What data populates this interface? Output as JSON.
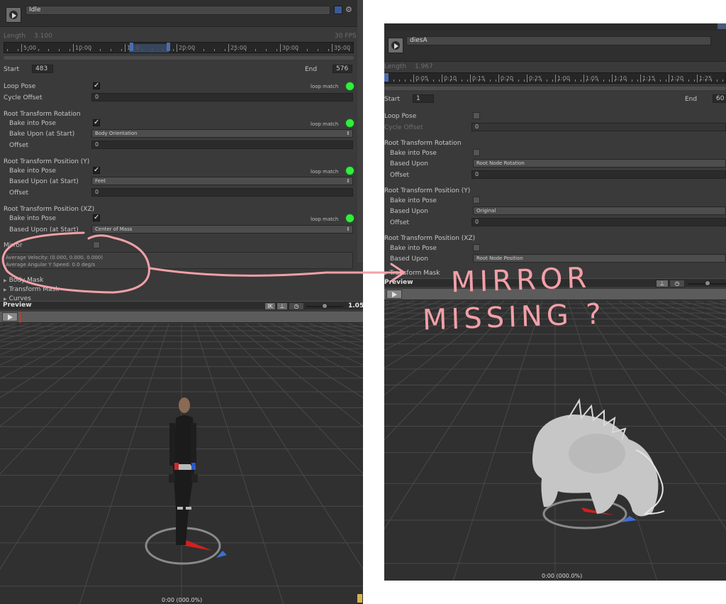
{
  "left_panel": {
    "clip_name": "Idle",
    "length_label": "Length",
    "length_value": "3.100",
    "fps": "30 FPS",
    "timeline_labels": [
      "5:00",
      "10:00",
      "1┃:0",
      "20:00",
      "25:00",
      "30:00",
      "35:00"
    ],
    "start_label": "Start",
    "start_value": "483",
    "end_label": "End",
    "end_value": "576",
    "loop_pose_label": "Loop Pose",
    "loop_match": "loop match",
    "cycle_offset_label": "Cycle Offset",
    "cycle_offset_value": "0",
    "rot_section": "Root Transform Rotation",
    "rot_bake_label": "Bake into Pose",
    "rot_based_label": "Bake Upon (at Start)",
    "rot_based_value": "Body Orientation",
    "rot_offset_label": "Offset",
    "rot_offset_value": "0",
    "posy_section": "Root Transform Position (Y)",
    "posy_bake_label": "Bake into Pose",
    "posy_based_label": "Based Upon (at Start)",
    "posy_based_value": "Feet",
    "posy_offset_label": "Offset",
    "posy_offset_value": "0",
    "posxz_section": "Root Transform Position (XZ)",
    "posxz_bake_label": "Bake into Pose",
    "posxz_based_label": "Based Upon (at Start)",
    "posxz_based_value": "Center of Mass",
    "mirror_label": "Mirror",
    "avg_velocity": "Average Velocity: (0.000, 0.000, 0.000)",
    "avg_angular": "Average Angular Y Speed: 0.0 deg/s",
    "body_mask": "Body Mask",
    "transform_mask": "Transform Mask",
    "curves": "Curves",
    "preview_title": "Preview",
    "ik_label": "IK",
    "speed_value": "1.05",
    "time_readout": "0:00 (000.0%)"
  },
  "right_panel": {
    "clip_name": "diesA",
    "length_label": "Length",
    "length_value": "1.967",
    "timeline_labels": [
      "0:05",
      "0:10",
      "0:15",
      "0:20",
      "0:25",
      "1:00",
      "1:05",
      "1:10",
      "1:15",
      "1:20",
      "1:25"
    ],
    "start_label": "Start",
    "start_value": "1",
    "end_label": "End",
    "end_value": "60",
    "loop_pose_label": "Loop Pose",
    "cycle_offset_label": "Cycle Offset",
    "cycle_offset_value": "0",
    "rot_section": "Root Transform Rotation",
    "rot_bake_label": "Bake into Pose",
    "rot_based_label": "Based Upon",
    "rot_based_value": "Root Node Rotation",
    "rot_offset_label": "Offset",
    "rot_offset_value": "0",
    "posy_section": "Root Transform Position (Y)",
    "posy_bake_label": "Bake into Pose",
    "posy_based_label": "Based Upon",
    "posy_based_value": "Original",
    "posy_offset_label": "Offset",
    "posy_offset_value": "0",
    "posxz_section": "Root Transform Position (XZ)",
    "posxz_bake_label": "Bake into Pose",
    "posxz_based_label": "Based Upon",
    "posxz_based_value": "Root Node Position",
    "transform_mask": "Transform Mask",
    "preview_title": "Preview",
    "time_readout": "0:00 (000.0%)"
  },
  "annotation": {
    "line1": "MIRROR",
    "line2": "MISSING ?",
    "color": "#f2a0a8"
  },
  "colors": {
    "panel_bg": "#3a3a3a",
    "loop_match_green": "#2ef13a",
    "viewport_bg": "#303030"
  }
}
